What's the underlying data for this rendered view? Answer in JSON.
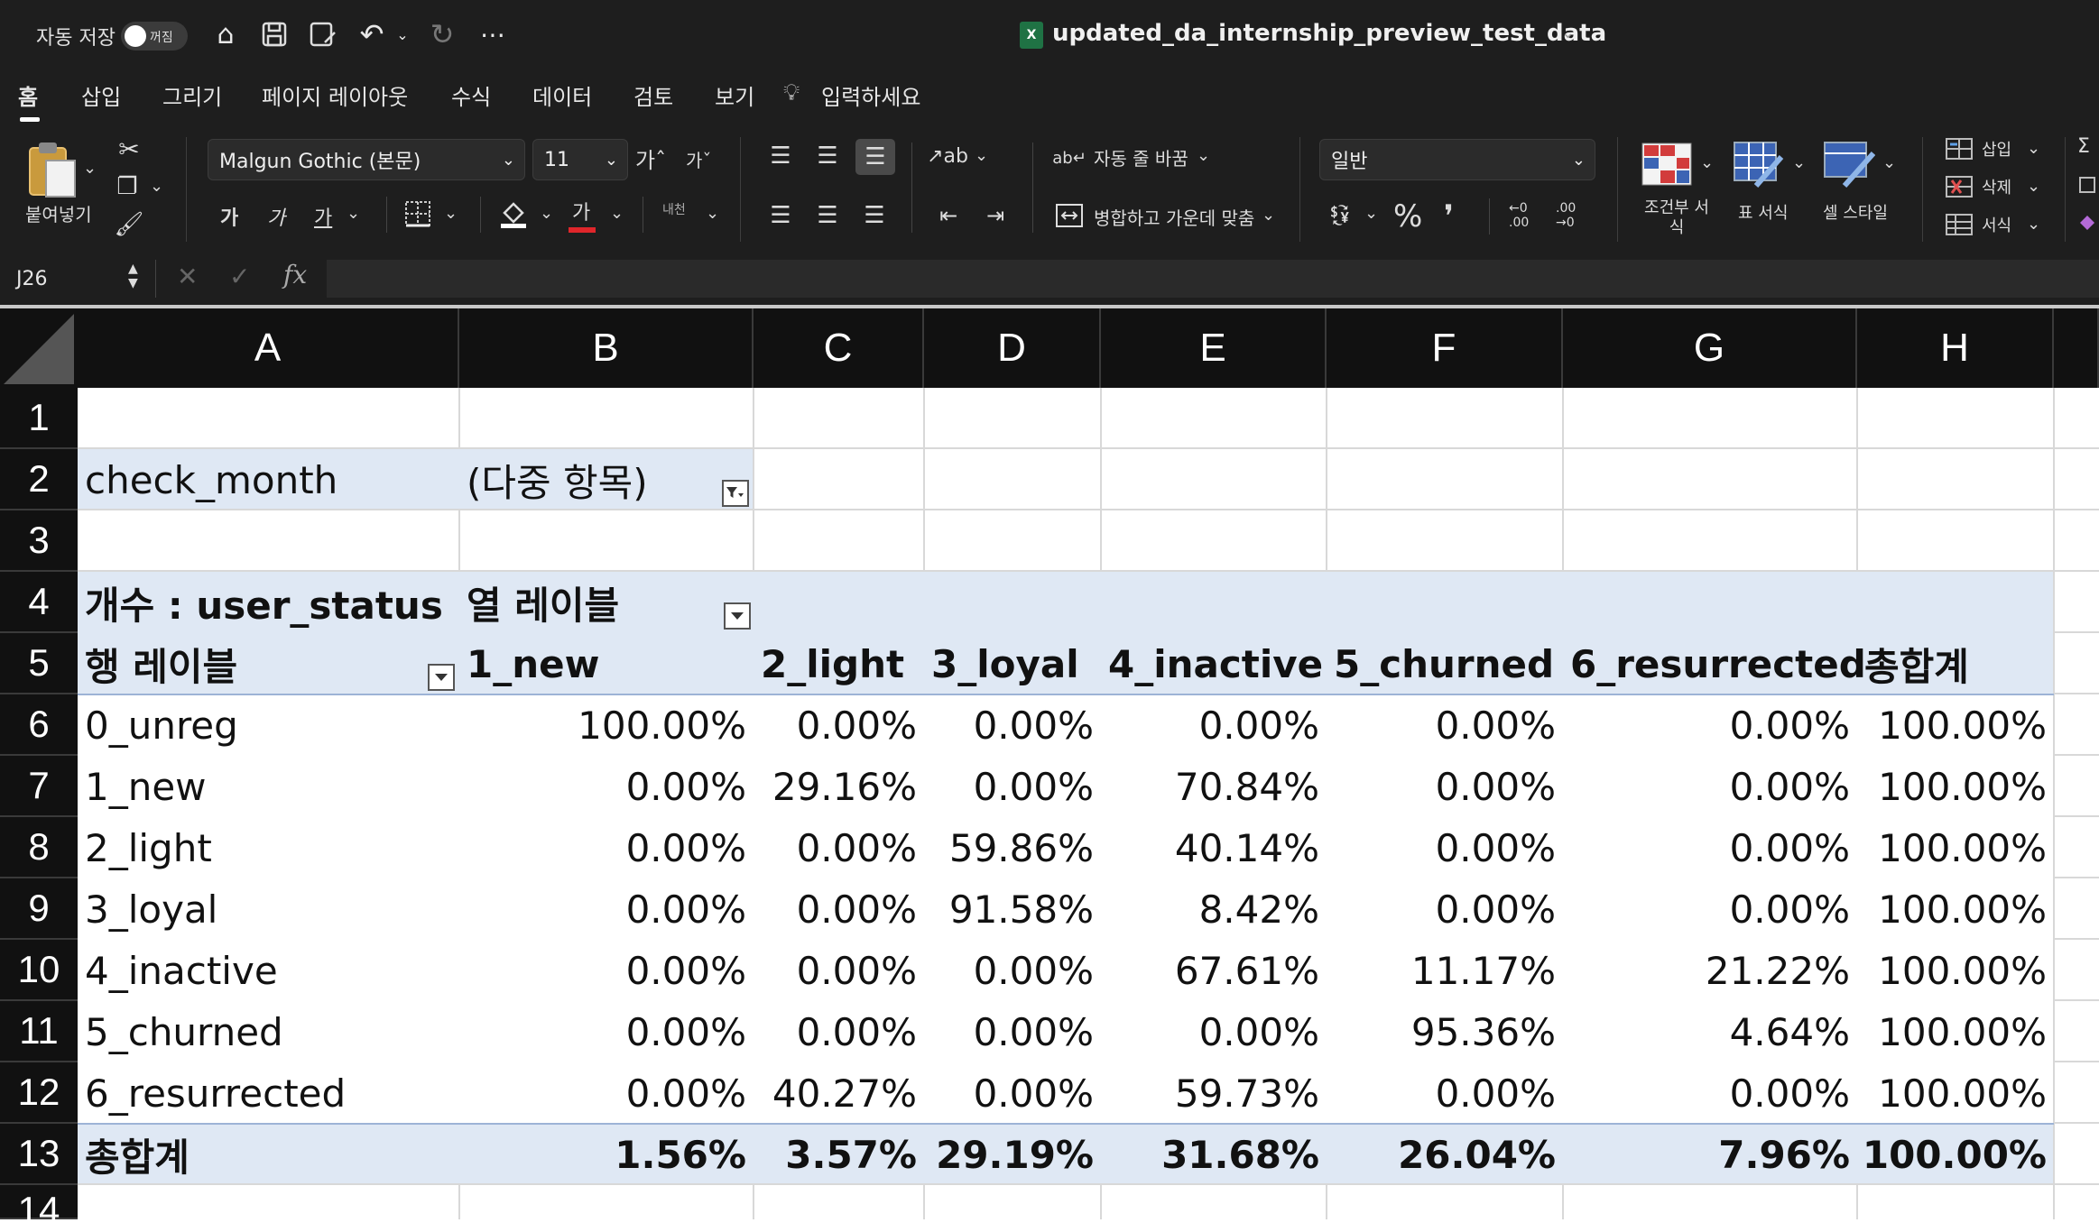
{
  "titlebar": {
    "autosave_label": "자동 저장",
    "autosave_state": "꺼짐",
    "filename": "updated_da_internship_preview_test_data"
  },
  "ribbon_tabs": [
    "홈",
    "삽입",
    "그리기",
    "페이지 레이아웃",
    "수식",
    "데이터",
    "검토",
    "보기"
  ],
  "tell_me": "입력하세요",
  "ribbon": {
    "paste_label": "붙여넣기",
    "font_name": "Malgun Gothic (본문)",
    "font_size": "11",
    "wrap_text": "자동 줄 바꿈",
    "merge_center": "병합하고 가운데 맞춤",
    "number_format": "일반",
    "conditional_format": "조건부 서식",
    "format_as_table": "표 서식",
    "cell_styles": "셀 스타일",
    "insert": "삽입",
    "delete": "삭제",
    "format": "서식",
    "percent": "%",
    "comma": "❜",
    "font_grow": "가ˆ",
    "font_shrink": "가ˇ",
    "bold_btn": "가",
    "italic_btn": "가",
    "underline_btn": "가",
    "font_color_btn": "가",
    "phonetic": "내천",
    "dec_inc": "←0 .00",
    "dec_dec": ".00 →0"
  },
  "formula_bar": {
    "name_box": "J26",
    "fx": "fx"
  },
  "columns": [
    "A",
    "B",
    "C",
    "D",
    "E",
    "F",
    "G",
    "H"
  ],
  "row_numbers": [
    "1",
    "2",
    "3",
    "4",
    "5",
    "6",
    "7",
    "8",
    "9",
    "10",
    "11",
    "12",
    "13",
    "14"
  ],
  "pivot": {
    "filter_field": "check_month",
    "filter_value": "(다중 항목)",
    "value_label": "개수 : user_status",
    "col_labels_header": "열 레이블",
    "row_labels_header": "행 레이블",
    "col_headers": [
      "1_new",
      "2_light",
      "3_loyal",
      "4_inactive",
      "5_churned",
      "6_resurrected",
      "총합계"
    ],
    "rows": [
      {
        "label": "0_unreg",
        "values": [
          "100.00%",
          "0.00%",
          "0.00%",
          "0.00%",
          "0.00%",
          "0.00%",
          "100.00%"
        ]
      },
      {
        "label": "1_new",
        "values": [
          "0.00%",
          "29.16%",
          "0.00%",
          "70.84%",
          "0.00%",
          "0.00%",
          "100.00%"
        ]
      },
      {
        "label": "2_light",
        "values": [
          "0.00%",
          "0.00%",
          "59.86%",
          "40.14%",
          "0.00%",
          "0.00%",
          "100.00%"
        ]
      },
      {
        "label": "3_loyal",
        "values": [
          "0.00%",
          "0.00%",
          "91.58%",
          "8.42%",
          "0.00%",
          "0.00%",
          "100.00%"
        ]
      },
      {
        "label": "4_inactive",
        "values": [
          "0.00%",
          "0.00%",
          "0.00%",
          "67.61%",
          "11.17%",
          "21.22%",
          "100.00%"
        ]
      },
      {
        "label": "5_churned",
        "values": [
          "0.00%",
          "0.00%",
          "0.00%",
          "0.00%",
          "95.36%",
          "4.64%",
          "100.00%"
        ]
      },
      {
        "label": "6_resurrected",
        "values": [
          "0.00%",
          "40.27%",
          "0.00%",
          "59.73%",
          "0.00%",
          "0.00%",
          "100.00%"
        ]
      }
    ],
    "total_label": "총합계",
    "total_values": [
      "1.56%",
      "3.57%",
      "29.19%",
      "31.68%",
      "26.04%",
      "7.96%",
      "100.00%"
    ]
  }
}
